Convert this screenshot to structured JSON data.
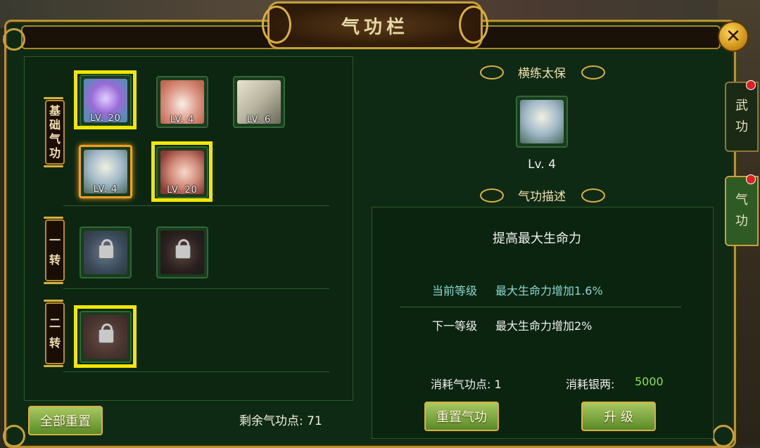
{
  "window": {
    "title": "气功栏"
  },
  "left": {
    "categories": [
      {
        "label": "基础气功",
        "chars": [
          "基",
          "础",
          "气",
          "功"
        ]
      },
      {
        "label": "一转",
        "chars": [
          "一",
          "转"
        ]
      },
      {
        "label": "二转",
        "chars": [
          "二",
          "转"
        ]
      }
    ],
    "skills": [
      {
        "name": "skill-purple-mask",
        "level": "LV. 20",
        "locked": false,
        "highlighted": true
      },
      {
        "name": "skill-wine-jar",
        "level": "LV. 4",
        "locked": false,
        "highlighted": false
      },
      {
        "name": "skill-scroll-blade",
        "level": "LV. 6",
        "locked": false,
        "highlighted": false
      },
      {
        "name": "skill-heng-lian-tai-bao",
        "level": "LV. 4",
        "locked": false,
        "highlighted": false,
        "selected": true
      },
      {
        "name": "skill-woman-portrait",
        "level": "LV. 20",
        "locked": false,
        "highlighted": true
      },
      {
        "name": "skill-wind-lock-1",
        "level": "",
        "locked": true,
        "highlighted": false
      },
      {
        "name": "skill-dark-claw-lock",
        "level": "",
        "locked": true,
        "highlighted": false
      },
      {
        "name": "skill-red-orbs-lock",
        "level": "",
        "locked": true,
        "highlighted": true
      }
    ],
    "reset_all_label": "全部重置",
    "remaining_label": "剩余气功点",
    "remaining_value": "71",
    "remaining_text": "剩余气功点: 71"
  },
  "detail": {
    "skill_name": "横练太保",
    "skill_level": "Lv. 4",
    "desc_header": "气功描述",
    "desc_title": "提高最大生命力",
    "current_label": "当前等级",
    "current_effect": "最大生命力增加1.6%",
    "next_label": "下一等级",
    "next_effect": "最大生命力增加2%",
    "cost_points_text": "消耗气功点: 1",
    "cost_silver_label": "消耗银两:",
    "cost_silver_value": "5000",
    "reset_button": "重置气功",
    "upgrade_button": "升 级"
  },
  "tabs": [
    {
      "label": "武功",
      "chars": [
        "武",
        "功"
      ],
      "active": false
    },
    {
      "label": "气功",
      "chars": [
        "气",
        "功"
      ],
      "active": true
    }
  ],
  "colors": {
    "panel_bg": "#0f2a14",
    "gold_border": "#b8922e",
    "highlight_yellow": "#f2e600",
    "current_level_teal": "#8ad8d0",
    "silver_value_green": "#8ae058"
  }
}
